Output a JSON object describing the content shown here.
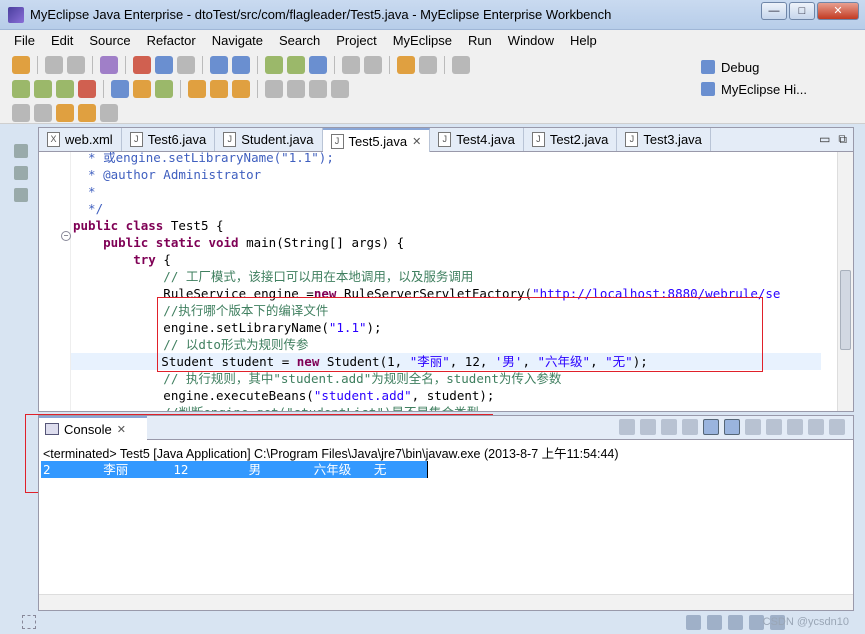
{
  "window": {
    "title": "MyEclipse Java Enterprise - dtoTest/src/com/flagleader/Test5.java - MyEclipse Enterprise Workbench",
    "buttons": {
      "minimize": "—",
      "maximize": "□",
      "close": "✕"
    }
  },
  "menu": [
    "File",
    "Edit",
    "Source",
    "Refactor",
    "Navigate",
    "Search",
    "Project",
    "MyEclipse",
    "Run",
    "Window",
    "Help"
  ],
  "perspectives": [
    "Debug",
    "MyEclipse Hi..."
  ],
  "editor": {
    "tabs": [
      {
        "label": "web.xml",
        "icon": "xml-file-icon"
      },
      {
        "label": "Test6.java",
        "icon": "java-file-icon"
      },
      {
        "label": "Student.java",
        "icon": "java-file-icon"
      },
      {
        "label": "Test5.java",
        "icon": "java-file-icon",
        "active": true
      },
      {
        "label": "Test4.java",
        "icon": "java-file-icon"
      },
      {
        "label": "Test2.java",
        "icon": "java-file-icon"
      },
      {
        "label": "Test3.java",
        "icon": "java-file-icon"
      }
    ],
    "tab_close": "✕",
    "controls": {
      "minimize": "▭",
      "maximize": "⧉"
    },
    "lines": [
      {
        "type": "cj",
        "text": "  * 或engine.setLibraryName(\"1.1\");"
      },
      {
        "type": "cj",
        "text": "  * @author Administrator"
      },
      {
        "type": "cj",
        "text": "  *"
      },
      {
        "type": "cj",
        "text": "  */"
      },
      {
        "type": "code",
        "parts": [
          [
            "kw",
            "public class "
          ],
          [
            "",
            "Test5 {"
          ]
        ]
      },
      {
        "type": "code",
        "parts": [
          [
            "",
            "    "
          ],
          [
            "kw",
            "public static void "
          ],
          [
            "",
            "main(String[] args) {"
          ]
        ]
      },
      {
        "type": "code",
        "parts": [
          [
            "",
            "        "
          ],
          [
            "kw",
            "try "
          ],
          [
            "",
            "{"
          ]
        ]
      },
      {
        "type": "cm",
        "text": "            // 工厂模式，该接口可以用在本地调用，以及服务调用"
      },
      {
        "type": "code",
        "parts": [
          [
            "",
            "            RuleService engine ="
          ],
          [
            "kw",
            "new "
          ],
          [
            "",
            "RuleServerServletFactory("
          ],
          [
            "st",
            "\"http://localhost:8880/webrule/se"
          ]
        ]
      },
      {
        "type": "cm",
        "text": "            //执行哪个版本下的编译文件"
      },
      {
        "type": "code",
        "parts": [
          [
            "",
            "            engine.setLibraryName("
          ],
          [
            "st",
            "\"1.1\""
          ],
          [
            "",
            ");"
          ]
        ]
      },
      {
        "type": "cm",
        "text": "            // 以dto形式为规则传参"
      },
      {
        "type": "code",
        "hl": true,
        "parts": [
          [
            "",
            "            Student student = "
          ],
          [
            "kw",
            "new "
          ],
          [
            "",
            "Student(1, "
          ],
          [
            "st",
            "\"李丽\""
          ],
          [
            "",
            ", 12, "
          ],
          [
            "st",
            "'男'"
          ],
          [
            "",
            ", "
          ],
          [
            "st",
            "\"六年级\""
          ],
          [
            "",
            ", "
          ],
          [
            "st",
            "\"无\""
          ],
          [
            "",
            ");"
          ]
        ]
      },
      {
        "type": "cm",
        "text": "            // 执行规则，其中\"student.add\"为规则全名，student为传入参数"
      },
      {
        "type": "code",
        "parts": [
          [
            "",
            "            engine.executeBeans("
          ],
          [
            "st",
            "\"student.add\""
          ],
          [
            "",
            ", student);"
          ]
        ]
      },
      {
        "type": "cm",
        "text": "            //判断engine.get(\"studentList\")是不是集合类型"
      }
    ]
  },
  "console": {
    "tab_label": "Console",
    "tab_close": "✕",
    "status": "<terminated> Test5 [Java Application] C:\\Program Files\\Java\\jre7\\bin\\javaw.exe (2013-8-7 上午11:54:44)",
    "output": "2       李丽      12        男       六年级   无"
  },
  "statusbar": {
    "watermark": "CSDN @ycsdn10"
  }
}
